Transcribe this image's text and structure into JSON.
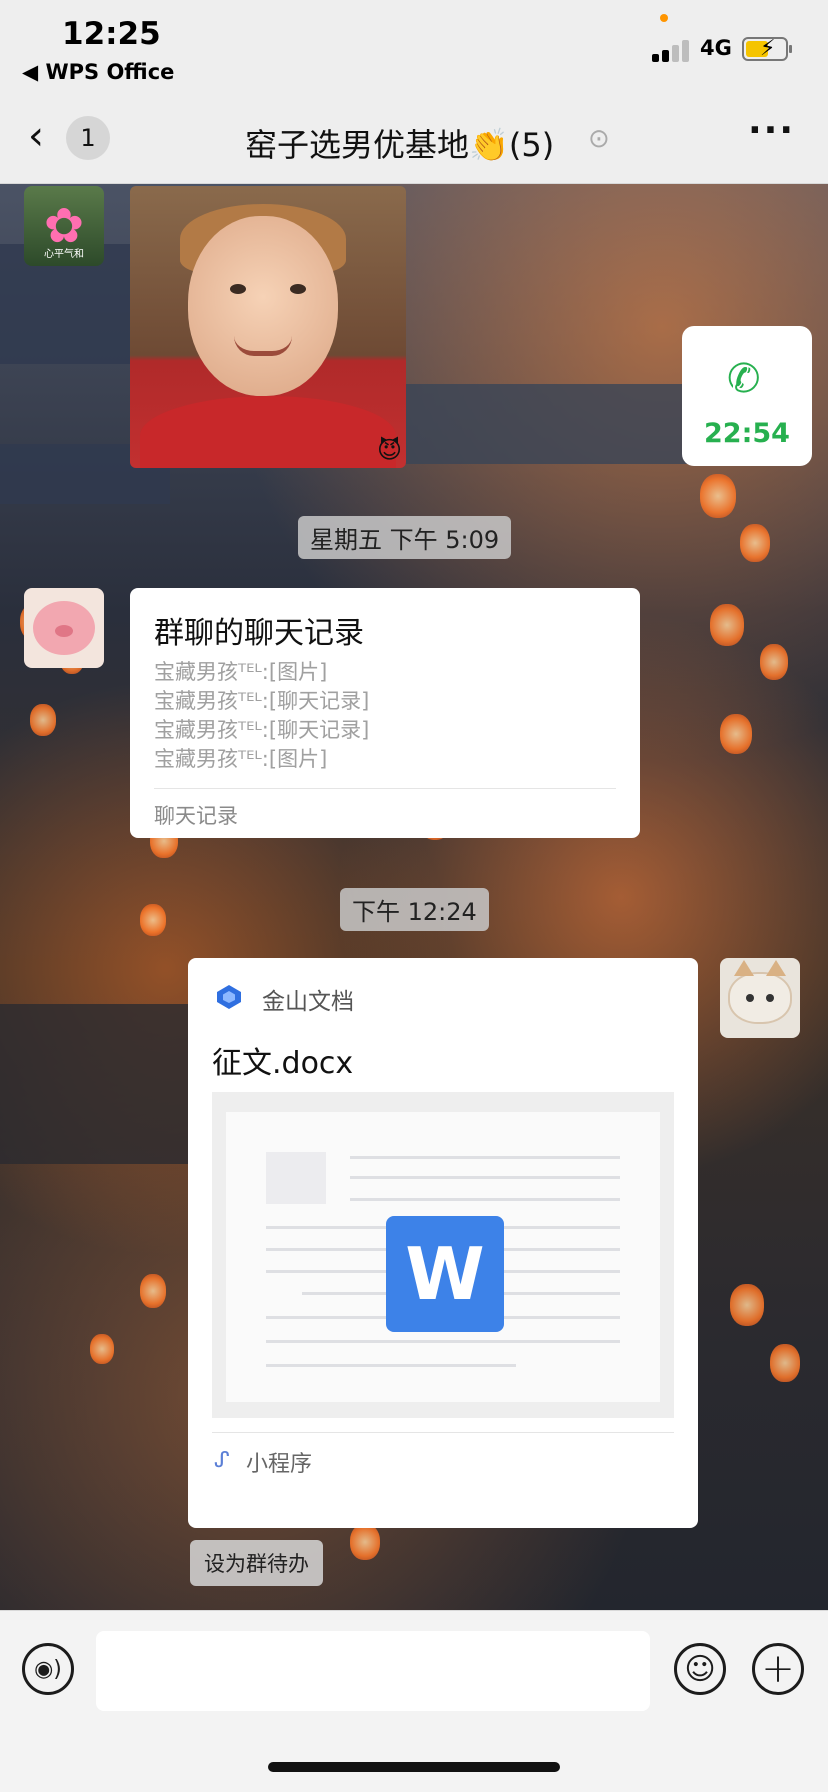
{
  "status_bar": {
    "time": "12:25",
    "back_app": "◀ WPS Office",
    "network": "4G",
    "battery_charging": true
  },
  "nav": {
    "back_icon": "chevron-left-icon",
    "unread_count": "1",
    "title": "窑子选男优基地👏(5)",
    "mute_icon": "ear-icon",
    "more_icon": "more-dots-icon"
  },
  "messages": [
    {
      "type": "image",
      "sender_avatar": "lotus-avatar",
      "avatar_caption": "心平气和",
      "sticker_icon": "devil-icon"
    },
    {
      "type": "voice_call",
      "direction": "outgoing",
      "duration": "22:54",
      "icon": "phone-icon"
    },
    {
      "type": "timestamp",
      "text": "星期五 下午 5:09"
    },
    {
      "type": "forwarded_chat",
      "sender_avatar": "pig-avatar",
      "title": "群聊的聊天记录",
      "lines": [
        "宝藏男孩ᵀᴱᴸ:[图片]",
        "宝藏男孩ᵀᴱᴸ:[聊天记录]",
        "宝藏男孩ᵀᴱᴸ:[聊天记录]",
        "宝藏男孩ᵀᴱᴸ:[图片]"
      ],
      "footer": "聊天记录"
    },
    {
      "type": "timestamp",
      "text": "下午 12:24"
    },
    {
      "type": "mini_program",
      "sender_avatar": "cat-avatar",
      "source": "金山文档",
      "title": "征文.docx",
      "preview_icon": "wps-w-icon",
      "preview_letter": "W",
      "footer": "小程序"
    }
  ],
  "todo_chip": "设为群待办",
  "input_bar": {
    "voice_icon": "voice-icon",
    "emoji_icon": "emoji-icon",
    "plus_icon": "plus-icon",
    "input_value": ""
  },
  "colors": {
    "accent_green": "#27b04f",
    "wps_blue": "#3d82e8",
    "nav_bg": "#eeeeee"
  }
}
